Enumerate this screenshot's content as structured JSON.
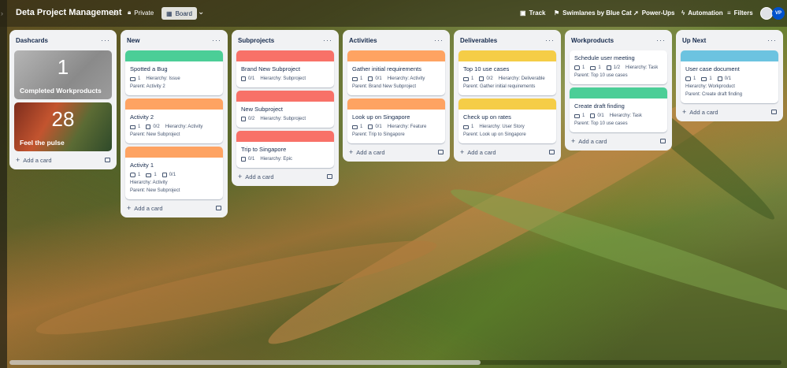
{
  "board": {
    "title": "Deta Project Management",
    "visibility": "Private",
    "view": "Board"
  },
  "toolbar": {
    "track": "Track",
    "swimlanes": "Swimlanes by Blue Cat",
    "powerups": "Power-Ups",
    "automation": "Automation",
    "filters": "Filters",
    "avatar_initials": "VP"
  },
  "colors": {
    "green": "#4bce97",
    "orange": "#fea362",
    "red": "#f87168",
    "yellow": "#f5cd47",
    "blue": "#6cc3e0"
  },
  "lists": [
    {
      "title": "Dashcards",
      "dashcards": [
        {
          "value": "1",
          "label": "Completed Workproducts"
        },
        {
          "value": "28",
          "label": "Feel the pulse"
        }
      ],
      "add": "Add a card"
    },
    {
      "title": "New",
      "cards": [
        {
          "cover": "green",
          "title": "Spotted a Bug",
          "badges": [
            "1"
          ],
          "hierarchy": "Hierarchy: Issue",
          "parent": "Parent: Activity 2"
        },
        {
          "cover": "orange",
          "title": "Activity 2",
          "badges": [
            "1",
            "0/2"
          ],
          "hierarchy": "Hierarchy: Activity",
          "parent": "Parent: New Subproject"
        },
        {
          "cover": "orange",
          "title": "Activity 1",
          "badges": [
            "1",
            "1",
            "0/1"
          ],
          "hierarchy": "Hierarchy: Activity",
          "parent": "Parent: New Subproject"
        }
      ],
      "add": "Add a card"
    },
    {
      "title": "Subprojects",
      "cards": [
        {
          "cover": "red",
          "title": "Brand New Subproject",
          "badges": [
            "0/1"
          ],
          "hierarchy": "Hierarchy: Subproject",
          "parent": ""
        },
        {
          "cover": "red",
          "title": "New Subproject",
          "badges": [
            "0/2"
          ],
          "hierarchy": "Hierarchy: Subproject",
          "parent": ""
        },
        {
          "cover": "red",
          "title": "Trip to Singapore",
          "badges": [
            "0/1"
          ],
          "hierarchy": "Hierarchy: Epic",
          "parent": ""
        }
      ],
      "add": "Add a card"
    },
    {
      "title": "Activities",
      "cards": [
        {
          "cover": "orange",
          "title": "Gather initial requirements",
          "badges": [
            "1",
            "0/1"
          ],
          "hierarchy": "Hierarchy: Activity",
          "parent": "Parent: Brand New Subproject"
        },
        {
          "cover": "orange",
          "title": "Look up on Singapore",
          "badges": [
            "1",
            "0/1"
          ],
          "hierarchy": "Hierarchy: Feature",
          "parent": "Parent: Trip to Singapore"
        }
      ],
      "add": "Add a card"
    },
    {
      "title": "Deliverables",
      "cards": [
        {
          "cover": "yellow",
          "title": "Top 10 use cases",
          "badges": [
            "1",
            "0/2"
          ],
          "hierarchy": "Hierarchy: Deliverable",
          "parent": "Parent: Gather initial requirements"
        },
        {
          "cover": "yellow",
          "title": "Check up on rates",
          "badges": [
            "1"
          ],
          "hierarchy": "Hierarchy: User Story",
          "parent": "Parent: Look up on Singapore"
        }
      ],
      "add": "Add a card"
    },
    {
      "title": "Workproducts",
      "cards": [
        {
          "cover": "",
          "title": "Schedule user meeting",
          "badges": [
            "1",
            "1",
            "1/2"
          ],
          "hierarchy": "Hierarchy: Task",
          "parent": "Parent: Top 10 use cases"
        },
        {
          "cover": "green",
          "title": "Create draft finding",
          "badges": [
            "1",
            "0/1"
          ],
          "hierarchy": "Hierarchy: Task",
          "parent": "Parent: Top 10 use cases"
        }
      ],
      "add": "Add a card"
    },
    {
      "title": "Up Next",
      "cards": [
        {
          "cover": "blue",
          "title": "User case document",
          "badges": [
            "1",
            "1",
            "0/1"
          ],
          "hierarchy": "Hierarchy: Workproduct",
          "parent": "Parent: Create draft finding"
        }
      ],
      "add": "Add a card"
    }
  ]
}
